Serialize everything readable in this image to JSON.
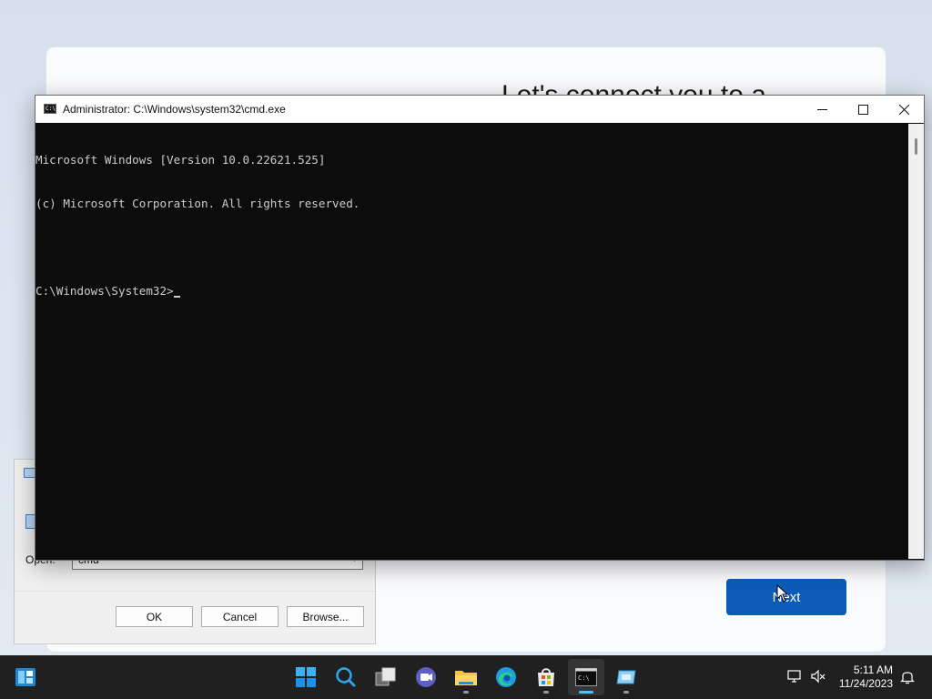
{
  "oobe": {
    "title": "Let's connect you to a",
    "next_label": "Next"
  },
  "run_dialog": {
    "open_label": "Open:",
    "open_value": "cmd",
    "ok_label": "OK",
    "cancel_label": "Cancel",
    "browse_label": "Browse..."
  },
  "cmd_window": {
    "title": "Administrator: C:\\Windows\\system32\\cmd.exe",
    "lines": [
      "Microsoft Windows [Version 10.0.22621.525]",
      "(c) Microsoft Corporation. All rights reserved.",
      "",
      "C:\\Windows\\System32>"
    ]
  },
  "taskbar": {
    "apps": [
      {
        "name": "start",
        "icon": "windows-start-icon"
      },
      {
        "name": "search",
        "icon": "search-icon"
      },
      {
        "name": "task-view",
        "icon": "task-view-icon"
      },
      {
        "name": "chat",
        "icon": "teams-chat-icon"
      },
      {
        "name": "file-explorer",
        "icon": "folder-icon"
      },
      {
        "name": "edge",
        "icon": "edge-icon"
      },
      {
        "name": "store",
        "icon": "store-icon"
      },
      {
        "name": "terminal",
        "icon": "cmd-icon"
      },
      {
        "name": "run",
        "icon": "run-icon"
      }
    ],
    "time": "5:11 AM",
    "date": "11/24/2023"
  },
  "colors": {
    "accent_blue": "#0b5cb8",
    "taskbar_bg": "#202020",
    "console_bg": "#0c0c0c",
    "console_text": "#cccccc",
    "active_indicator": "#4cc2ff"
  }
}
